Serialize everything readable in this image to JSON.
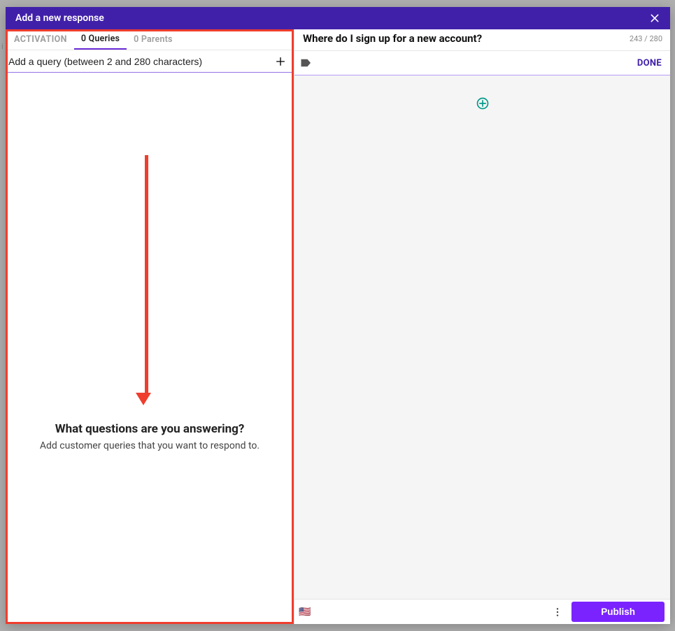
{
  "header": {
    "title": "Add a new response"
  },
  "left": {
    "tabs": {
      "activation": "ACTIVATION",
      "queries": "0 Queries",
      "parents": "0 Parents"
    },
    "query_input": {
      "placeholder": "Add a query (between 2 and 280 characters)"
    },
    "empty": {
      "heading": "What questions are you answering?",
      "sub": "Add customer queries that you want to respond to."
    }
  },
  "right": {
    "title": "Where do I sign up for a new account?",
    "char_count": "243 / 280",
    "done": "DONE"
  },
  "footer": {
    "flag": "🇺🇸",
    "publish": "Publish"
  }
}
